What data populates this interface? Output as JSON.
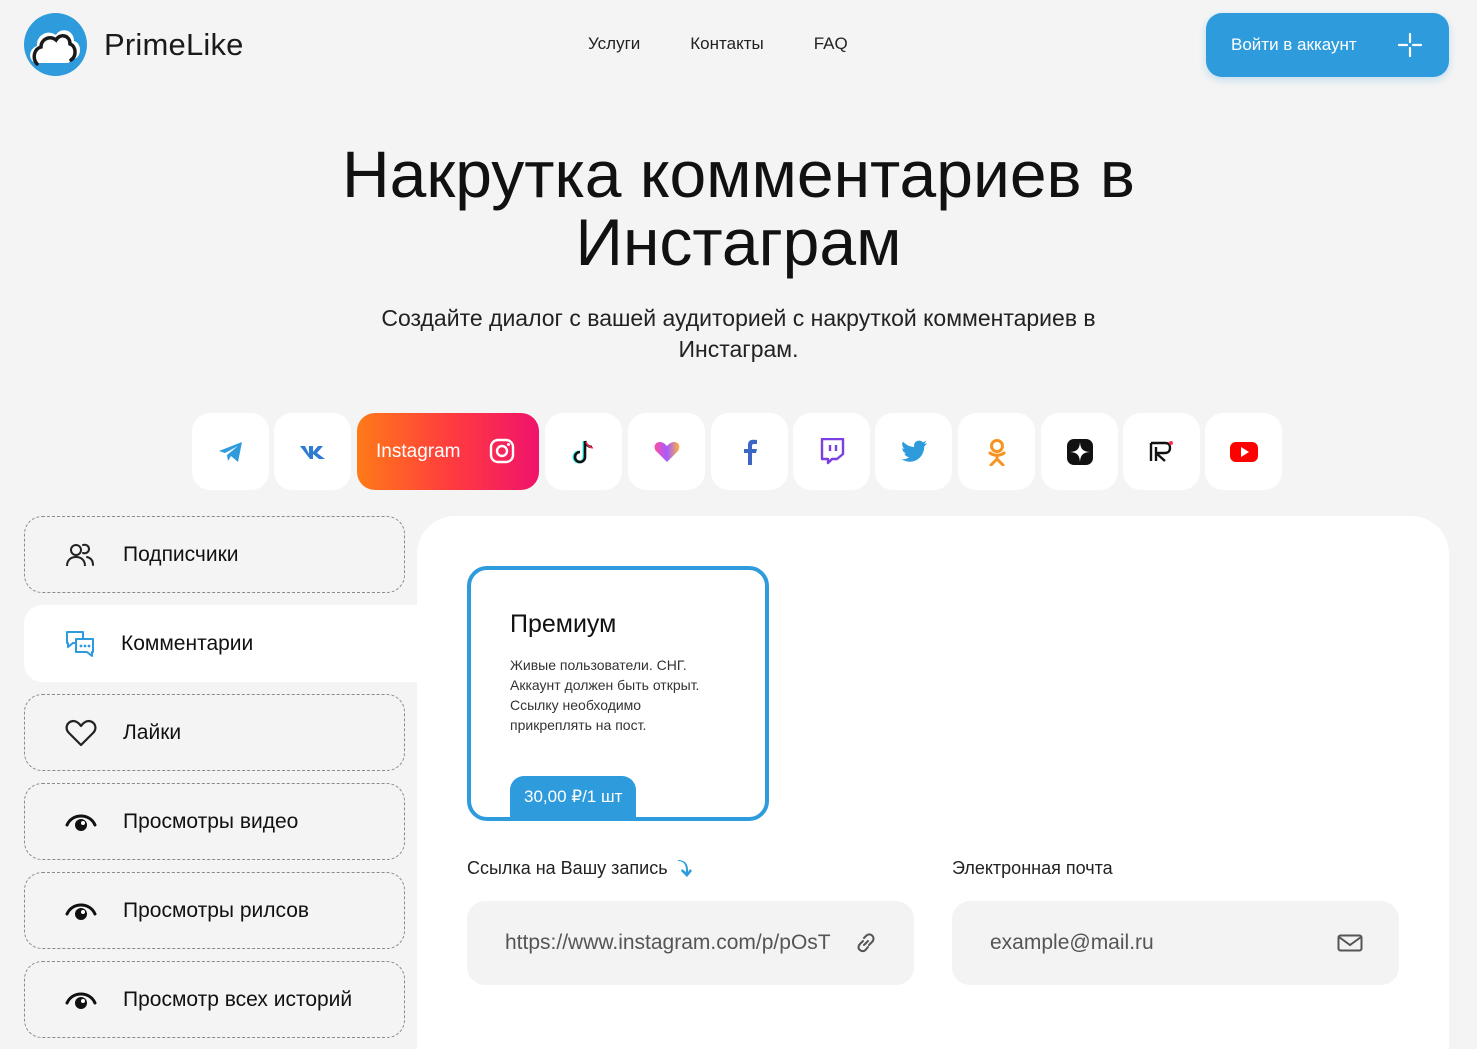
{
  "header": {
    "logo_text": "PrimeLike",
    "nav": [
      "Услуги",
      "Контакты",
      "FAQ"
    ],
    "login_label": "Войти в аккаунт"
  },
  "hero": {
    "title_line1": "Накрутка комментариев в",
    "title_line2": "Инстаграм",
    "subtitle_line1": "Создайте диалог с вашей аудиторией с накруткой комментариев в",
    "subtitle_line2": "Инстаграм."
  },
  "platforms": {
    "active_label": "Instagram",
    "items": [
      "telegram-icon",
      "vk-icon",
      "instagram-icon",
      "tiktok-icon",
      "likee-icon",
      "facebook-icon",
      "twitch-icon",
      "twitter-icon",
      "odnoklassniki-icon",
      "zen-icon",
      "rutube-icon",
      "youtube-icon"
    ]
  },
  "sidebar": {
    "items": [
      {
        "label": "Подписчики",
        "icon": "users-icon"
      },
      {
        "label": "Комментарии",
        "icon": "comments-icon"
      },
      {
        "label": "Лайки",
        "icon": "heart-icon"
      },
      {
        "label": "Просмотры видео",
        "icon": "eye-icon"
      },
      {
        "label": "Просмотры рилсов",
        "icon": "eye-icon"
      },
      {
        "label": "Просмотр всех историй",
        "icon": "eye-icon"
      }
    ]
  },
  "card": {
    "title": "Премиум",
    "desc_lines": [
      "Живые пользователи. СНГ.",
      "Аккаунт должен быть открыт.",
      "Ссылку необходимо",
      "прикреплять на пост."
    ],
    "price": "30,00 ₽/1 шт"
  },
  "form": {
    "link_label": "Ссылка на Вашу запись",
    "link_value": "https://www.instagram.com/p/pOsT",
    "email_label": "Электронная почта",
    "email_placeholder": "example@mail.ru"
  },
  "colors": {
    "accent": "#2e9bdc",
    "background": "#f4f4f4"
  }
}
